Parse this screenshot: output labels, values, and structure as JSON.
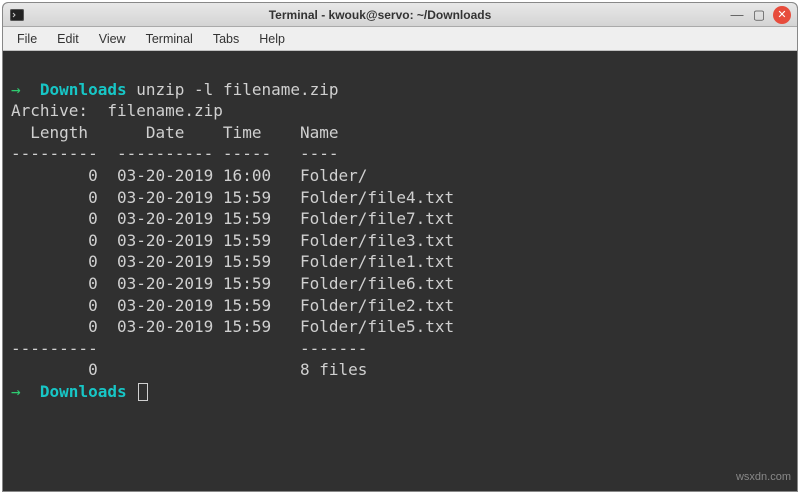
{
  "titlebar": {
    "title": "Terminal - kwouk@servo: ~/Downloads"
  },
  "menubar": {
    "file": "File",
    "edit": "Edit",
    "view": "View",
    "terminal": "Terminal",
    "tabs": "Tabs",
    "help": "Help"
  },
  "prompt": {
    "arrow": "→",
    "cwd": "Downloads",
    "command": "unzip -l filename.zip"
  },
  "output": {
    "archive_line": "Archive:  filename.zip",
    "header": "  Length      Date    Time    Name",
    "sep_top": "---------  ---------- -----   ----",
    "rows": [
      "        0  03-20-2019 16:00   Folder/",
      "        0  03-20-2019 15:59   Folder/file4.txt",
      "        0  03-20-2019 15:59   Folder/file7.txt",
      "        0  03-20-2019 15:59   Folder/file3.txt",
      "        0  03-20-2019 15:59   Folder/file1.txt",
      "        0  03-20-2019 15:59   Folder/file6.txt",
      "        0  03-20-2019 15:59   Folder/file2.txt",
      "        0  03-20-2019 15:59   Folder/file5.txt"
    ],
    "sep_bot": "---------                     -------",
    "total": "        0                     8 files"
  },
  "prompt2": {
    "arrow": "→",
    "cwd": "Downloads"
  },
  "watermark": "wsxdn.com"
}
